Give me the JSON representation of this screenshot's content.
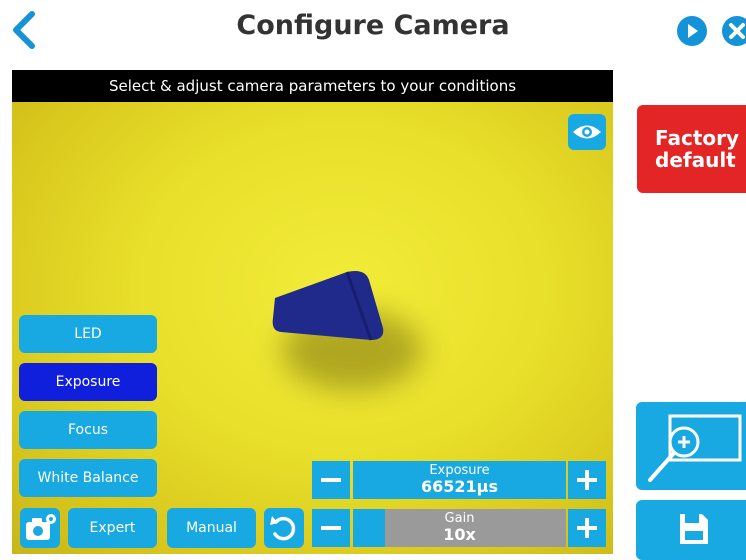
{
  "header": {
    "title": "Configure Camera"
  },
  "view": {
    "banner": "Select & adjust camera parameters to your conditions"
  },
  "buttons": {
    "led": "LED",
    "exposure": "Exposure",
    "focus": "Focus",
    "white_balance": "White Balance",
    "expert": "Expert",
    "manual": "Manual",
    "factory_default": "Factory default"
  },
  "exposure_control": {
    "label": "Exposure",
    "value": "66521µs"
  },
  "gain_control": {
    "label": "Gain",
    "value": "10x"
  },
  "colors": {
    "accent": "#18a9e2",
    "active": "#0f1fdc",
    "danger": "#e32525",
    "header_icon": "#1493d8"
  },
  "icons": [
    "back-icon",
    "play-icon",
    "close-icon",
    "eye-icon",
    "camera-settings-icon",
    "reset-icon",
    "zoom-icon",
    "save-icon"
  ]
}
